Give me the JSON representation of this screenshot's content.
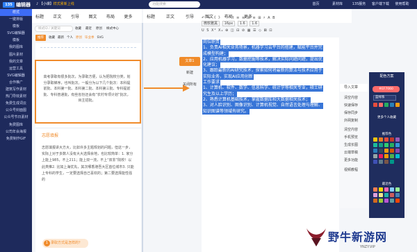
{
  "topbar": {
    "logo_mark": "135",
    "logo_text": "编辑器",
    "notice_left": "♪ 【小课】",
    "notice_right": "样式累新上线",
    "search_placeholder": "功能搜索",
    "nav": [
      "首页",
      "素材库",
      "135服务",
      "客户端下载",
      "使用帮助"
    ]
  },
  "leftnav": {
    "items": [
      "样式",
      "一键排版",
      "模板",
      "SVG编辑器",
      "模板",
      "我的图库",
      "图片素材",
      "我的文章",
      "运营工具",
      "SVG编辑器",
      "合作推广",
      "建筑写作素材",
      "热门导效素材",
      "免费生成词云",
      "公众号封面图",
      "公众号节日素材",
      "免费图库",
      "公司年会海报",
      "免费制作GIF"
    ],
    "active_index": 0
  },
  "template_panel": {
    "tabs": [
      "标题",
      "正文",
      "引导",
      "图文",
      "布局",
      "更多"
    ],
    "search_placeholder": "样式ID / 关键词",
    "filters": [
      "收藏",
      "最近",
      "原创",
      "样式中心"
    ],
    "subtabs": [
      "推荐",
      "收藏",
      "最新",
      "个人",
      "原创",
      "毕业季",
      "SVG"
    ],
    "card1_text": "高考录取有很多批次，为录取方便，认为把院校分类，划分录取梯序，也叫批次。一般分为以下几个批次：本科提前批、本科第一批、本科第二批、本科第三批、专科提前批、专科普通批，有些省份还会有”农村专项计划”批次，目主招批。",
    "card2_title": "志愿填报",
    "card2_text": "志愿填报讲大方大，比如许多主题规划的问题，但这一步，实际上对于多数人没有大大选择余地，也比较简单：1. 家分上能上985，不上211；能上双一流，不上“双非”院校！以此类推2. 比如上海优先，其次哪香港吾大区首位城市3. 只能上专科的学生，一定要选择自己喜欢的；第二要选择能性强的",
    "card2_foot_num": "1",
    "card2_foot": "录取方式是怎样的？"
  },
  "editor": {
    "tabs": [
      "标题",
      "正文",
      "引导",
      "图文",
      "布局",
      "更多"
    ],
    "toolbar_row1": "↶ ↷ 《 》 “ ” I ≡ ≡ ≡ ≡ ⊞ ♯ A B",
    "toolbar_row2": [
      "微软雅黑",
      "16px",
      "1.6",
      "1.6"
    ],
    "toolbar_row3": "U S X² X₂ ⊕ ◫ ⊟ ⊘ ▦ ☰ ◇ ⊠ ⊡",
    "mid_buttons": [
      "文章1",
      "新建",
      "关闭所有"
    ],
    "document_lines": [
      "岗位职责",
      "1、负责AI相关业务场景，机器学习云平台的搭建，赋能平台并完",
      "成模型构建；",
      "2、应用机器学习，数据挖掘等技术，解决实际问题问题，提出优",
      "化建议；",
      "3、跟踪最新的AI研究技术，探索如何将最新的算法与技术应用于",
      "实际业务，实现AI应用创新",
      "工作要求",
      "1、计算机、软件、数学、信息科学、统计学等相关专业，硕士研",
      "究生及以上学历；",
      "2、熟悉计算机基础技术，掌握数据库和大数据相关技术；",
      "3、对人脸识别、图像识别、计算机视觉、自然语言处理与理解、",
      "知识图谱等领域有研究。"
    ]
  },
  "right_menu": [
    "导入文章",
    "",
    "清空内容",
    "快速保存",
    "保存同步",
    "外网复制",
    "",
    "清空内容",
    "手机预览",
    "生成长图",
    "云端草稿",
    "更多功能",
    "",
    "视频教程"
  ],
  "color_panel": {
    "title": "配色方案",
    "code": "#EF7060",
    "select_value": "蓝绿系",
    "more": "更多个人收藏",
    "label_hot": "推荐色",
    "label_new": "最近色",
    "swatches1": [
      "#e74c3c",
      "#ff6b6b",
      "#27ae60",
      "#2980b9",
      "#f39c12"
    ],
    "swatches_hot": [
      "#f1c40f",
      "#e67e22",
      "#e74c3c",
      "#c0392b",
      "#9b59b6",
      "#1abc9c",
      "#16a085",
      "#2ecc71",
      "#27ae60",
      "#3498db",
      "#2980b9",
      "#34495e",
      "#f39c12",
      "#d35400",
      "#8e44ad",
      "#95a5a6",
      "#e91e63",
      "#ff9800",
      "#4caf50",
      "#00bcd4",
      "#3f51b5",
      "#607d8b",
      "#795548",
      "#009688"
    ],
    "swatches_new": [
      "#ff7f50",
      "#ffd700",
      "#ff69b4",
      "#87cefa",
      "#98fb98",
      "#dda0dd",
      "#f0e68c",
      "#20b2aa",
      "#cd5c5c",
      "#4682b4",
      "#d2691e",
      "#9acd32",
      "#ba55d3",
      "#5f9ea0",
      "#ff4500"
    ]
  },
  "watermark": {
    "text": "野牛新游网",
    "url": "YNZY.VIP"
  }
}
